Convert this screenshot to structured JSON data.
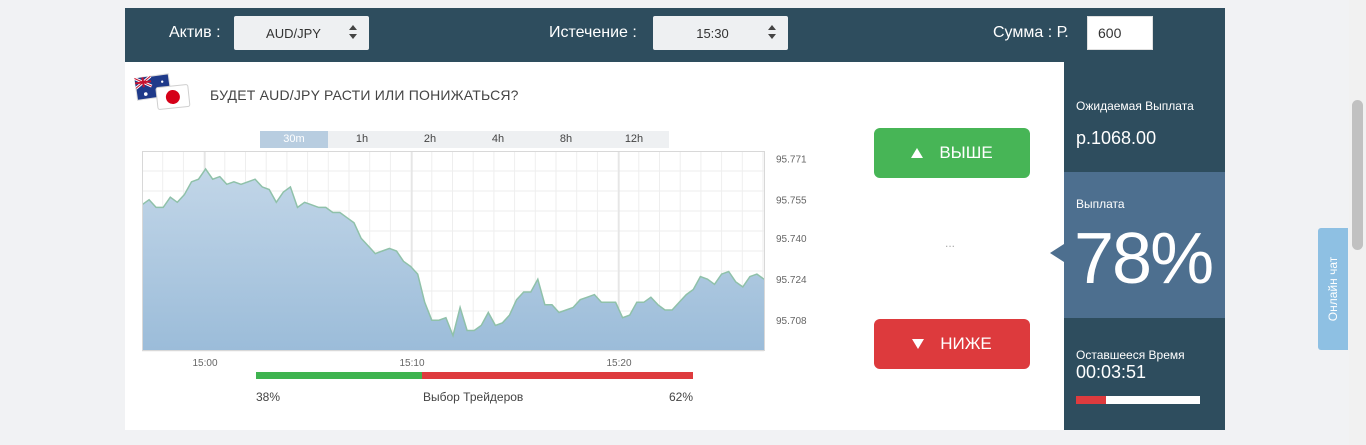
{
  "topbar": {
    "asset_label": "Актив :",
    "asset_value": "AUD/JPY",
    "expiry_label": "Истечение :",
    "expiry_value": "15:30",
    "amount_label": "Сумма : Р.",
    "amount_value": "600"
  },
  "question": "БУДЕТ AUD/JPY РАСТИ ИЛИ ПОНИЖАТЬСЯ?",
  "timeframes": [
    "30m",
    "1h",
    "2h",
    "4h",
    "8h",
    "12h"
  ],
  "active_timeframe": "30m",
  "buttons": {
    "up": "ВЫШЕ",
    "down": "НИЖЕ"
  },
  "placeholder_dots": "...",
  "traders": {
    "label": "Выбор Трейдеров",
    "up_percent": "38%",
    "down_percent": "62%",
    "up_fraction": 0.38,
    "up_color": "#3eb34f",
    "down_color": "#de3b3e"
  },
  "sidebar": {
    "expected_payout_label": "Ожидаемая Выплата",
    "expected_payout_value": "р.1068.00",
    "payout_label": "Выплата",
    "payout_value": "78%",
    "remaining_label": "Оставшееся Время",
    "remaining_value": "00:03:51",
    "remaining_fraction": 0.24
  },
  "chat_label": "Онлайн чат",
  "chart_data": {
    "type": "area",
    "x_ticks": [
      "15:00",
      "15:10",
      "15:20"
    ],
    "y_ticks": [
      "95.771",
      "95.755",
      "95.740",
      "95.724",
      "95.708"
    ],
    "ylim": [
      95.696,
      95.774
    ],
    "grid": true,
    "colors": {
      "line": "#8fc1a9",
      "fill_top": "#c2d6e8",
      "fill_bottom": "#9bbcd9"
    },
    "values": [
      95.753,
      95.755,
      95.752,
      95.752,
      95.756,
      95.754,
      95.757,
      95.762,
      95.763,
      95.767,
      95.763,
      95.764,
      95.761,
      95.762,
      95.761,
      95.762,
      95.763,
      95.76,
      95.759,
      95.754,
      95.758,
      95.76,
      95.752,
      95.754,
      95.753,
      95.752,
      95.752,
      95.75,
      95.75,
      95.748,
      95.746,
      95.74,
      95.737,
      95.734,
      95.735,
      95.736,
      95.735,
      95.731,
      95.729,
      95.726,
      95.715,
      95.708,
      95.708,
      95.709,
      95.702,
      95.713,
      95.704,
      95.704,
      95.706,
      95.711,
      95.706,
      95.707,
      95.71,
      95.716,
      95.719,
      95.719,
      95.724,
      95.714,
      95.714,
      95.711,
      95.712,
      95.713,
      95.716,
      95.717,
      95.718,
      95.715,
      95.715,
      95.715,
      95.709,
      95.71,
      95.715,
      95.715,
      95.717,
      95.714,
      95.712,
      95.712,
      95.715,
      95.718,
      95.72,
      95.725,
      95.724,
      95.722,
      95.726,
      95.727,
      95.723,
      95.721,
      95.725,
      95.726,
      95.724
    ]
  }
}
